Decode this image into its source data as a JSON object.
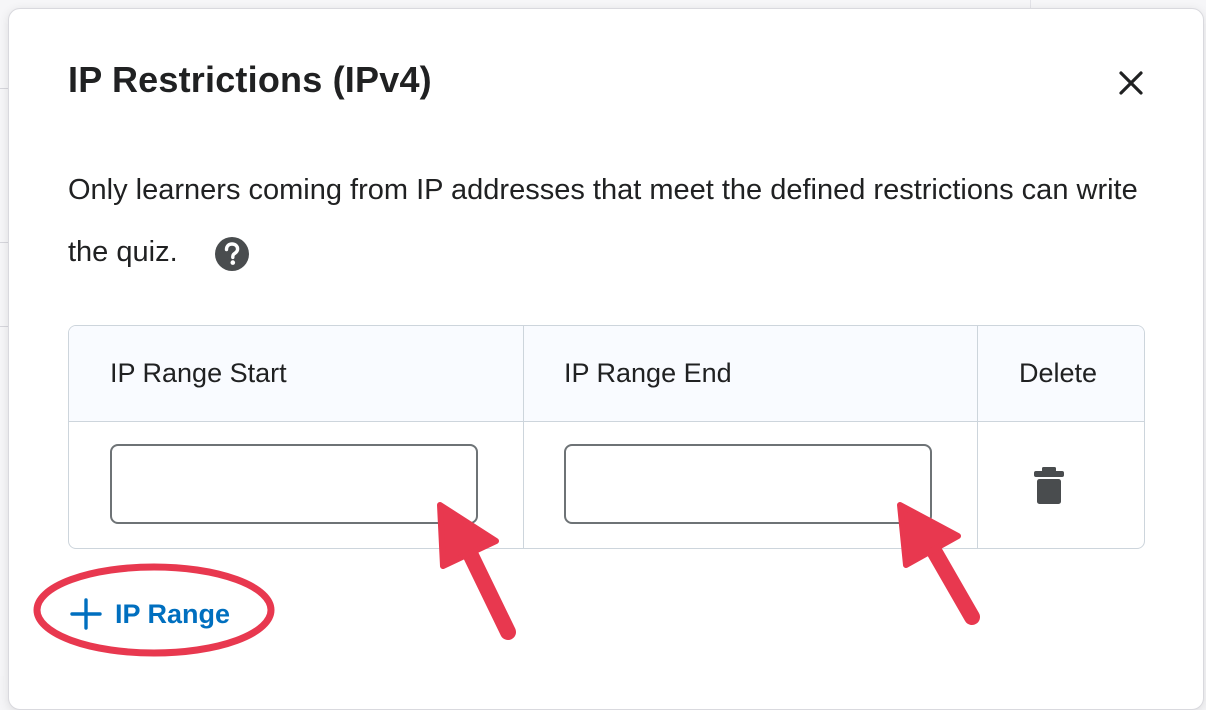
{
  "dialog": {
    "title": "IP Restrictions (IPv4)",
    "description": "Only learners coming from IP addresses that meet the defined restrictions can write the quiz."
  },
  "table": {
    "headers": {
      "start": "IP Range Start",
      "end": "IP Range End",
      "delete": "Delete"
    },
    "rows": [
      {
        "start": "",
        "end": ""
      }
    ]
  },
  "actions": {
    "add_range_label": "IP Range"
  },
  "colors": {
    "accent": "#006fbf",
    "annotation": "#e8384f"
  },
  "icons": {
    "close": "close-icon",
    "help": "help-icon",
    "delete": "trash-icon",
    "add": "plus-icon"
  }
}
